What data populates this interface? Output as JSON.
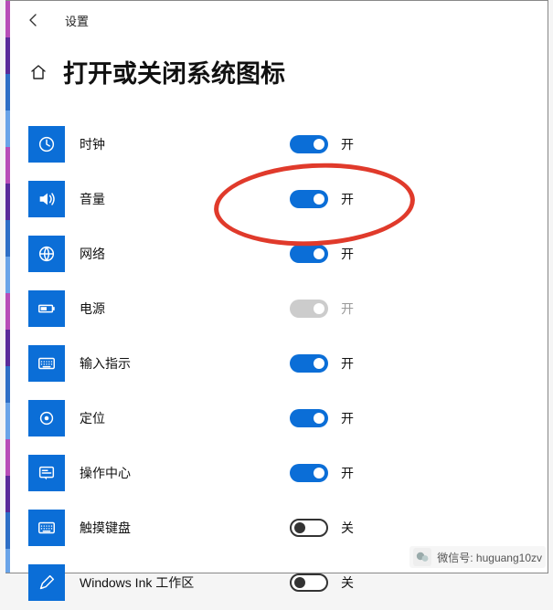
{
  "topbar": {
    "label": "设置"
  },
  "header": {
    "title": "打开或关闭系统图标"
  },
  "state_labels": {
    "on": "开",
    "off": "关"
  },
  "rows": [
    {
      "key": "clock",
      "label": "时钟",
      "state": "on",
      "icon": "clock"
    },
    {
      "key": "volume",
      "label": "音量",
      "state": "on",
      "icon": "volume",
      "highlight": true
    },
    {
      "key": "network",
      "label": "网络",
      "state": "on",
      "icon": "globe"
    },
    {
      "key": "power",
      "label": "电源",
      "state": "disabled",
      "icon": "battery"
    },
    {
      "key": "ime",
      "label": "输入指示",
      "state": "on",
      "icon": "keyboard"
    },
    {
      "key": "location",
      "label": "定位",
      "state": "on",
      "icon": "target"
    },
    {
      "key": "actioncenter",
      "label": "操作中心",
      "state": "on",
      "icon": "action"
    },
    {
      "key": "touchkb",
      "label": "触摸键盘",
      "state": "off",
      "icon": "keyboard"
    },
    {
      "key": "ink",
      "label": "Windows Ink 工作区",
      "state": "off",
      "icon": "pen"
    }
  ],
  "colors": {
    "accent": "#0b6ed7",
    "highlight": "#e03a2b"
  },
  "overlay": {
    "wechat_label": "微信号: huguang10zv"
  }
}
